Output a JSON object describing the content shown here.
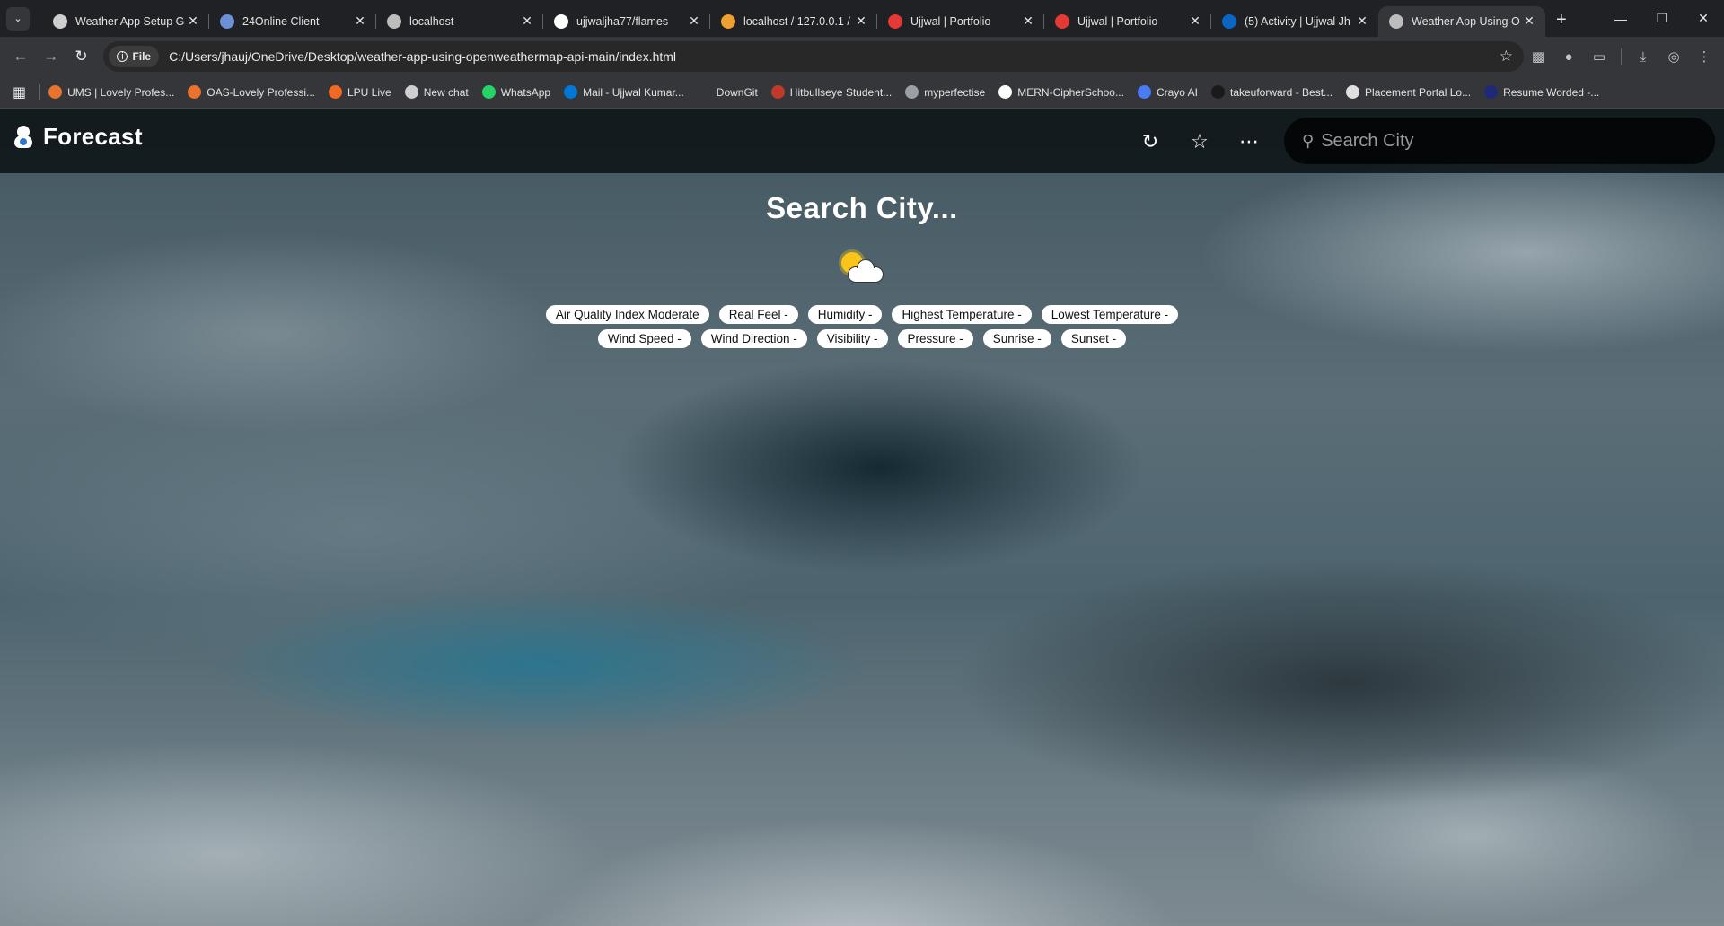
{
  "browser": {
    "tabs": [
      {
        "title": "Weather App Setup G",
        "favicon": "chatgpt-icon",
        "color": "#cfcfcf",
        "active": false
      },
      {
        "title": "24Online Client",
        "favicon": "cloud-icon",
        "color": "#6c8fd6",
        "active": false
      },
      {
        "title": "localhost",
        "favicon": "globe-icon",
        "color": "#bdbdbd",
        "active": false
      },
      {
        "title": "ujjwaljha77/flames",
        "favicon": "github-icon",
        "color": "#ffffff",
        "active": false
      },
      {
        "title": "localhost / 127.0.0.1 /",
        "favicon": "phpmyadmin-icon",
        "color": "#f0a030",
        "active": false
      },
      {
        "title": "Ujjwal | Portfolio",
        "favicon": "portfolio-icon",
        "color": "#e53935",
        "active": false
      },
      {
        "title": "Ujjwal | Portfolio",
        "favicon": "portfolio-icon",
        "color": "#e53935",
        "active": false
      },
      {
        "title": "(5) Activity | Ujjwal Jh",
        "favicon": "linkedin-icon",
        "color": "#0a66c2",
        "active": false
      },
      {
        "title": "Weather App Using O",
        "favicon": "globe-icon",
        "color": "#bdbdbd",
        "active": true
      }
    ],
    "address": {
      "chip": "File",
      "url": "C:/Users/jhauj/OneDrive/Desktop/weather-app-using-openweathermap-api-main/index.html"
    },
    "bookmarks": [
      {
        "label": "UMS | Lovely Profes...",
        "color": "#e8732c"
      },
      {
        "label": "OAS-Lovely Professi...",
        "color": "#e8732c"
      },
      {
        "label": "LPU Live",
        "color": "#f26a21"
      },
      {
        "label": "New chat",
        "color": "#cfcfcf"
      },
      {
        "label": "WhatsApp",
        "color": "#25d366"
      },
      {
        "label": "Mail - Ujjwal Kumar...",
        "color": "#0078d4"
      },
      {
        "label": "DownGit",
        "color": "#35363a"
      },
      {
        "label": "Hitbullseye Student...",
        "color": "#c0392b"
      },
      {
        "label": "myperfectise",
        "color": "#9aa0a6"
      },
      {
        "label": "MERN-CipherSchoo...",
        "color": "#ffffff"
      },
      {
        "label": "Crayo AI",
        "color": "#4a7bf7"
      },
      {
        "label": "takeuforward - Best...",
        "color": "#1a1a1a"
      },
      {
        "label": "Placement Portal Lo...",
        "color": "#e0e0e0"
      },
      {
        "label": "Resume Worded -...",
        "color": "#1e2a78"
      }
    ]
  },
  "app": {
    "brand": "Forecast",
    "search_placeholder": "Search City",
    "headline": "Search City...",
    "stats_row1": [
      "Air Quality Index Moderate",
      "Real Feel -",
      "Humidity -",
      "Highest Temperature -",
      "Lowest Temperature -"
    ],
    "stats_row2": [
      "Wind Speed -",
      "Wind Direction -",
      "Visibility -",
      "Pressure -",
      "Sunrise -",
      "Sunset -"
    ]
  }
}
